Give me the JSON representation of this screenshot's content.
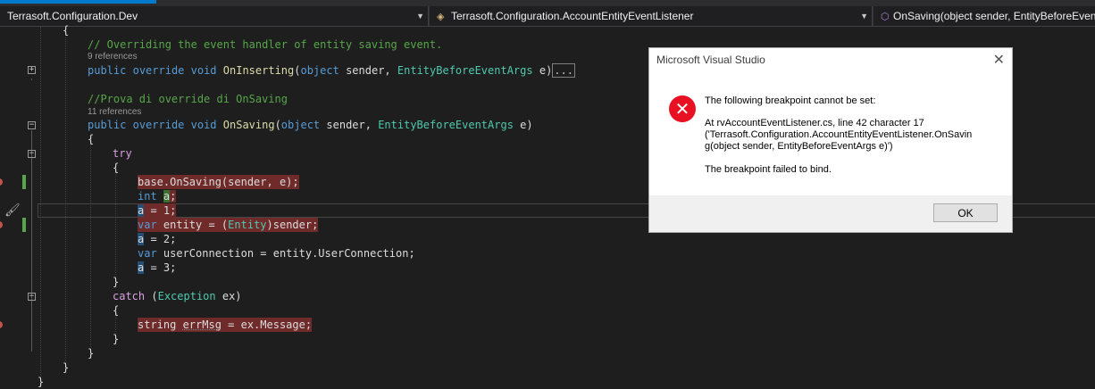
{
  "nav": {
    "project": "Terrasoft.Configuration.Dev",
    "class": "Terrasoft.Configuration.AccountEntityEventListener",
    "member": "OnSaving(object sender, EntityBeforeEventArgs e)"
  },
  "code": {
    "brace_open_1": "{",
    "comment_1": "// Overriding the event handler of entity saving event.",
    "refs_1": "9 references",
    "kw_public_1": "public",
    "kw_override_1": "override",
    "kw_void_1": "void",
    "fn_inserting": "OnInserting",
    "kw_object_1": "object",
    "sender_1": "sender,",
    "type_args_1": "EntityBeforeEventArgs",
    "param_e_1": "e)",
    "collapsed": "...",
    "comment_2": "//Prova di override di OnSaving",
    "refs_2": "11 references",
    "fn_saving": "OnSaving",
    "param_e_2": "e)",
    "brace_open_2": "{",
    "kw_try": "try",
    "brace_open_3": "{",
    "l_base": "base.OnSaving(sender, e);",
    "kw_int": "int",
    "var_a": "a",
    "semicolon": ";",
    "l_a1_rest": " = 1;",
    "kw_var_1": "var",
    "l_entity_1": " entity = (",
    "type_entity": "Entity",
    "l_entity_2": ")sender;",
    "l_a2_rest": " = 2;",
    "kw_var_2": "var",
    "l_uc": " userConnection = entity.UserConnection;",
    "l_a3_rest": " = 3;",
    "brace_close_3": "}",
    "kw_catch": "catch",
    "paren_open": "(",
    "type_exception": "Exception",
    "ex_rest": " ex)",
    "brace_open_4": "{",
    "l_string": "string ",
    "l_errmsg": "errMsg",
    "l_msg_rest": " = ex.Message;",
    "brace_close_4": "}",
    "brace_close_2": "}",
    "brace_close_1": "}",
    "brace_close_0": "}"
  },
  "dialog": {
    "title": "Microsoft Visual Studio",
    "line1": "The following breakpoint cannot be set:",
    "line2": "At rvAccountEventListener.cs, line 42 character 17",
    "line3": "('Terrasoft.Configuration.AccountEntityEventListener.OnSavin",
    "line4": "g(object sender, EntityBeforeEventArgs e)')",
    "line5": "The breakpoint failed to bind.",
    "ok": "OK"
  }
}
